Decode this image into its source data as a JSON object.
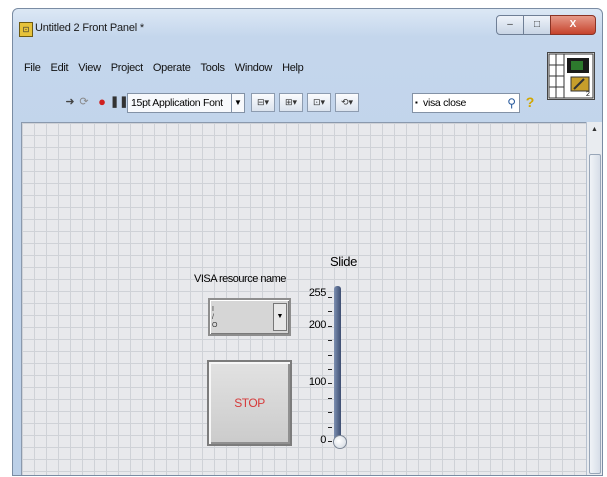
{
  "window": {
    "title": "Untitled 2 Front Panel *",
    "icon": "labview-vi-icon",
    "controls": {
      "minimize": "–",
      "maximize": "□",
      "close": "X"
    }
  },
  "menu": [
    "File",
    "Edit",
    "View",
    "Project",
    "Operate",
    "Tools",
    "Window",
    "Help"
  ],
  "toolbar": {
    "run_icon": "run-arrow-icon",
    "run_continuously_icon": "run-continuously-icon",
    "abort_icon": "abort-execution-icon",
    "pause_icon": "pause-icon",
    "font_selector": "15pt Application Font",
    "align_icon": "align-objects-icon",
    "distribute_icon": "distribute-objects-icon",
    "resize_icon": "resize-objects-icon",
    "reorder_icon": "reorder-icon",
    "search_value": "visa close",
    "search_icon": "magnifier-icon",
    "help_icon": "context-help-icon"
  },
  "panel": {
    "visa_label": "VISA resource name",
    "stop_button_label": "STOP",
    "slide": {
      "label": "Slide",
      "min": 0,
      "max": 255,
      "value": 0,
      "ticks": [
        "255",
        "200",
        "100",
        "0"
      ]
    }
  }
}
